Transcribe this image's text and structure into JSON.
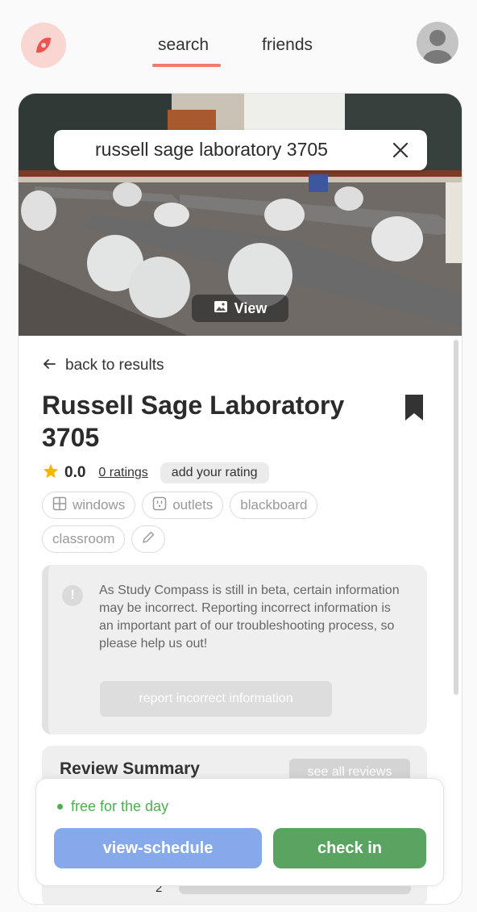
{
  "header": {
    "logo_icon": "compass-logo-icon",
    "tabs": [
      {
        "label": "search",
        "active": true
      },
      {
        "label": "friends",
        "active": false
      }
    ],
    "avatar_icon": "user-avatar-icon"
  },
  "photo": {
    "search_value": "russell sage laboratory 3705",
    "view_label": "View"
  },
  "detail": {
    "back_label": "back to results",
    "title": "Russell Sage Laboratory 3705",
    "rating_value": "0.0",
    "rating_count": "0 ratings",
    "add_rating_label": "add your rating",
    "tags": [
      {
        "label": "windows",
        "icon": "window-icon"
      },
      {
        "label": "outlets",
        "icon": "outlet-icon"
      },
      {
        "label": "blackboard",
        "icon": ""
      },
      {
        "label": "classroom",
        "icon": ""
      }
    ]
  },
  "notice": {
    "text": "As Study Compass is still in beta, certain information may be incorrect. Reporting incorrect information is an important part of our troubleshooting process, so please help us out!",
    "button_label": "report incorrect information"
  },
  "review": {
    "title": "Review Summary",
    "see_all_label": "see all reviews",
    "bar_label": "2"
  },
  "bottom": {
    "status": "free for the day",
    "schedule_label": "view-schedule",
    "checkin_label": "check in"
  },
  "colors": {
    "accent": "#f07a72",
    "status_green": "#4caf50",
    "schedule_blue": "#86a9ec",
    "checkin_green": "#5aa462",
    "star": "#f5b700"
  }
}
